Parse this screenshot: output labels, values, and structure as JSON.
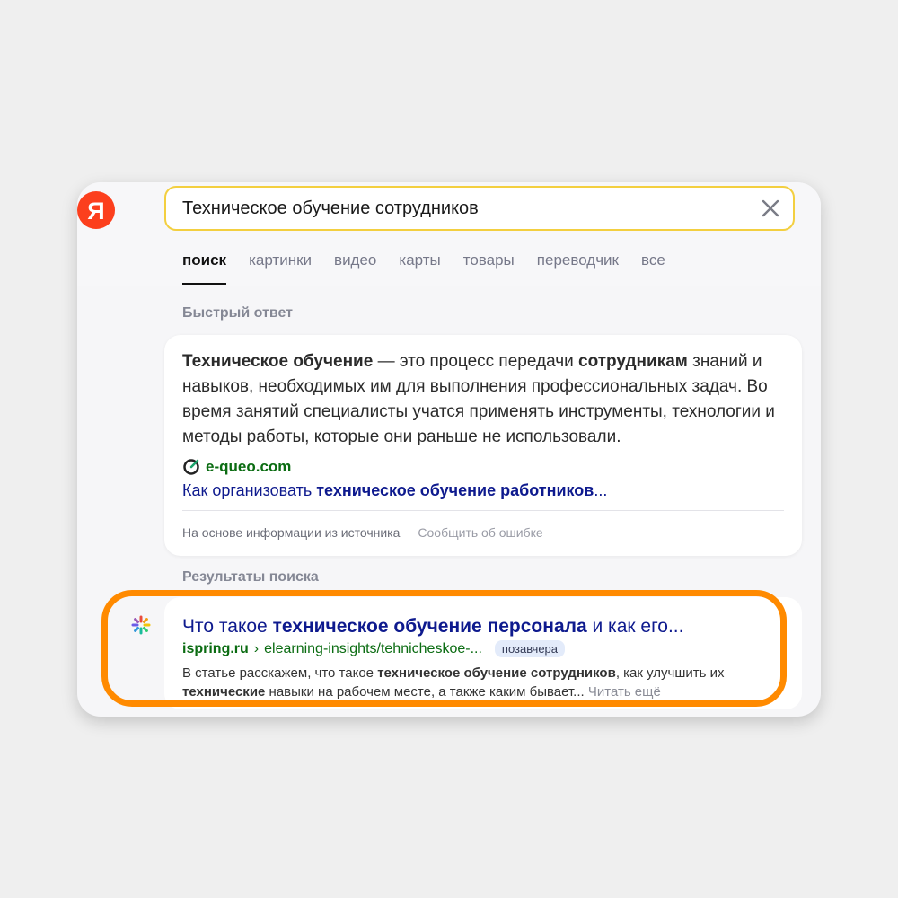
{
  "logo": "Я",
  "search": {
    "value": "Техническое обучение сотрудников"
  },
  "tabs": [
    {
      "label": "поиск"
    },
    {
      "label": "картинки"
    },
    {
      "label": "видео"
    },
    {
      "label": "карты"
    },
    {
      "label": "товары"
    },
    {
      "label": "переводчик"
    },
    {
      "label": "все"
    }
  ],
  "quick_answer": {
    "section_title": "Быстрый ответ",
    "text_bold_1": "Техническое обучение",
    "text_1": " — это процесс передачи ",
    "text_bold_2": "сотрудникам",
    "text_2": " знаний и навыков, необходимых им для выполнения профессиональных задач. Во время занятий специалисты учатся применять инструменты, технологии и методы работы, которые они раньше не использовали.",
    "source_name": "e-queo.com",
    "source_link_prefix": "Как организовать ",
    "source_link_bold": "техническое обучение работников",
    "source_link_suffix": "...",
    "footer_note": "На основе информации из источника",
    "report_link": "Сообщить об ошибке"
  },
  "results": {
    "section_title": "Результаты поиска",
    "items": [
      {
        "title_prefix": "Что такое ",
        "title_bold": "техническое обучение персонала",
        "title_suffix": " и как его...",
        "domain": "ispring.ru",
        "separator": "›",
        "path": "elearning-insights/tehnicheskoe-...",
        "badge": "позавчера",
        "snippet_1": "В статье расскажем, что такое ",
        "snippet_bold_1": "техническое обучение сотрудников",
        "snippet_2": ", как улучшить их ",
        "snippet_bold_2": "технические",
        "snippet_3": " навыки на рабочем месте, а также каким бывает...",
        "read_more": "Читать ещё"
      }
    ]
  },
  "colors": {
    "logo": "#fc3f1d",
    "search_border": "#f3cf40",
    "link": "#0e1a8e",
    "url": "#0b6c12",
    "highlight": "#ff8a00"
  }
}
